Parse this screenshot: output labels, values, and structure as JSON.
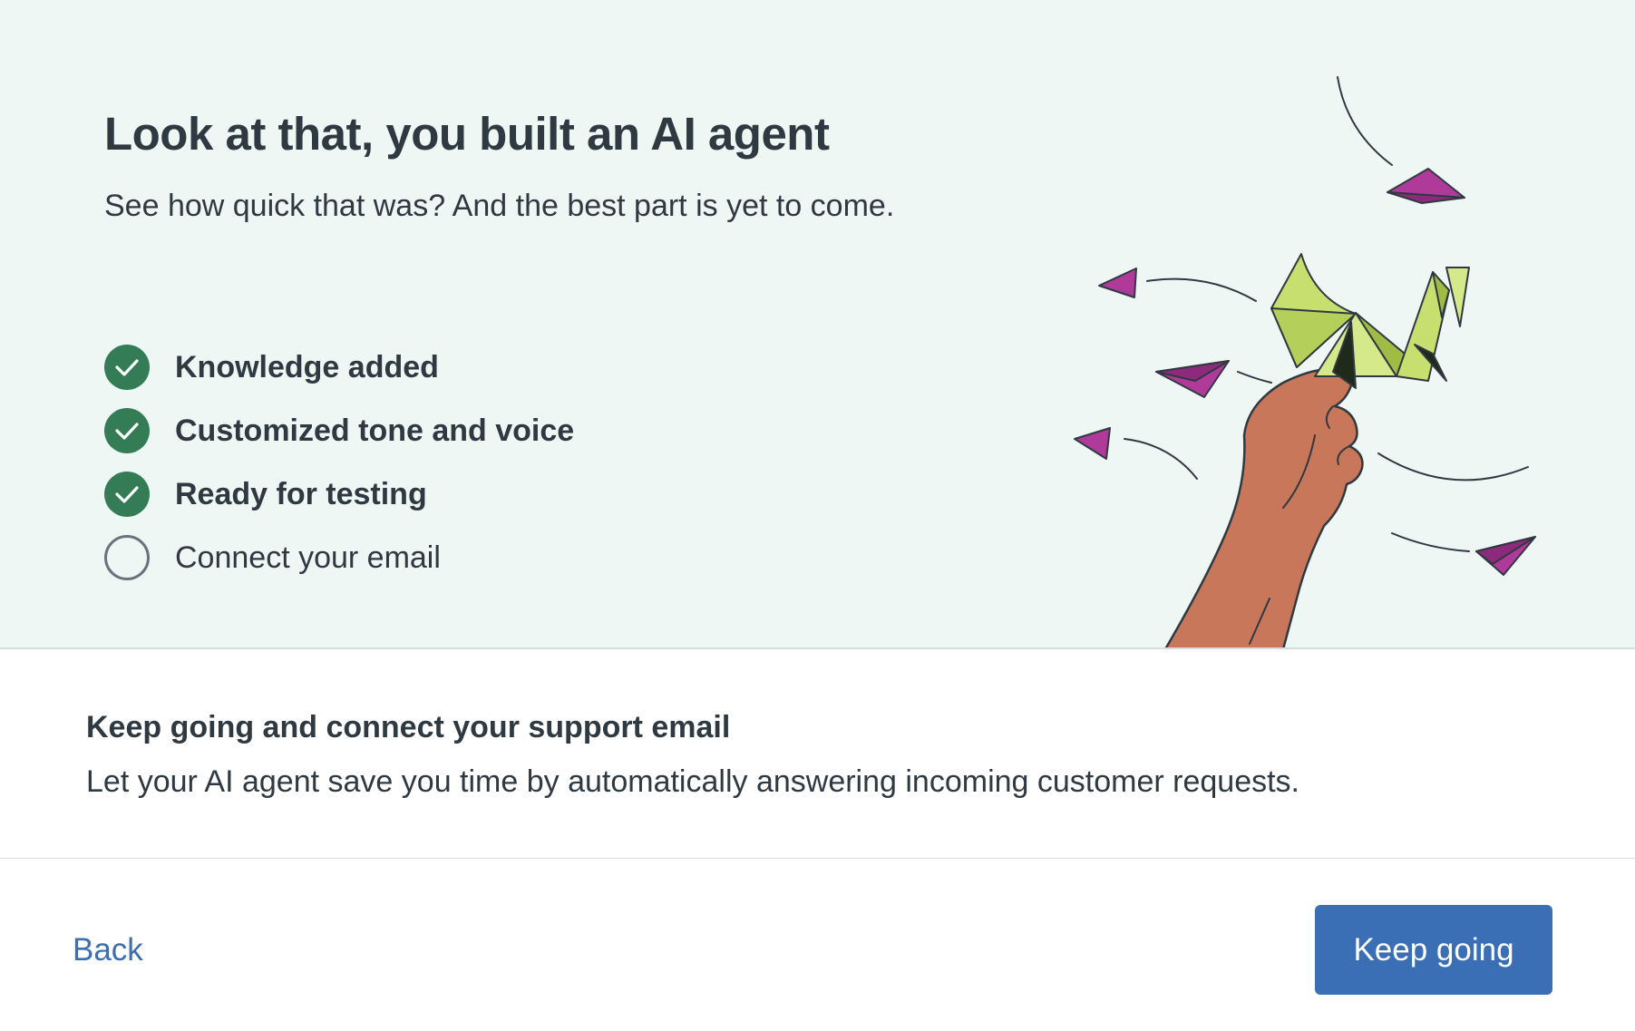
{
  "hero": {
    "title": "Look at that, you built an AI agent",
    "subtitle": "See how quick that was? And the best part is yet to come.",
    "steps": [
      {
        "label": "Knowledge added",
        "status": "complete",
        "icon": "check-circle-icon"
      },
      {
        "label": "Customized tone and voice",
        "status": "complete",
        "icon": "check-circle-icon"
      },
      {
        "label": "Ready for testing",
        "status": "complete",
        "icon": "check-circle-icon"
      },
      {
        "label": "Connect your email",
        "status": "incomplete",
        "icon": "empty-circle-icon"
      }
    ],
    "illustration": "hand-holding-origami-crane-with-paper-planes"
  },
  "content": {
    "title": "Keep going and connect your support email",
    "body": "Let your AI agent save you time by automatically answering incoming customer requests."
  },
  "footer": {
    "back_label": "Back",
    "primary_label": "Keep going"
  },
  "colors": {
    "hero_background": "#eef7f4",
    "check_green": "#337c56",
    "primary_blue": "#3a6fb5",
    "link_blue": "#3a6fb0",
    "text_dark": "#2f3941",
    "plane_magenta": "#b03a9a",
    "crane_green": "#c7df6f",
    "hand_brown": "#c8775a"
  }
}
